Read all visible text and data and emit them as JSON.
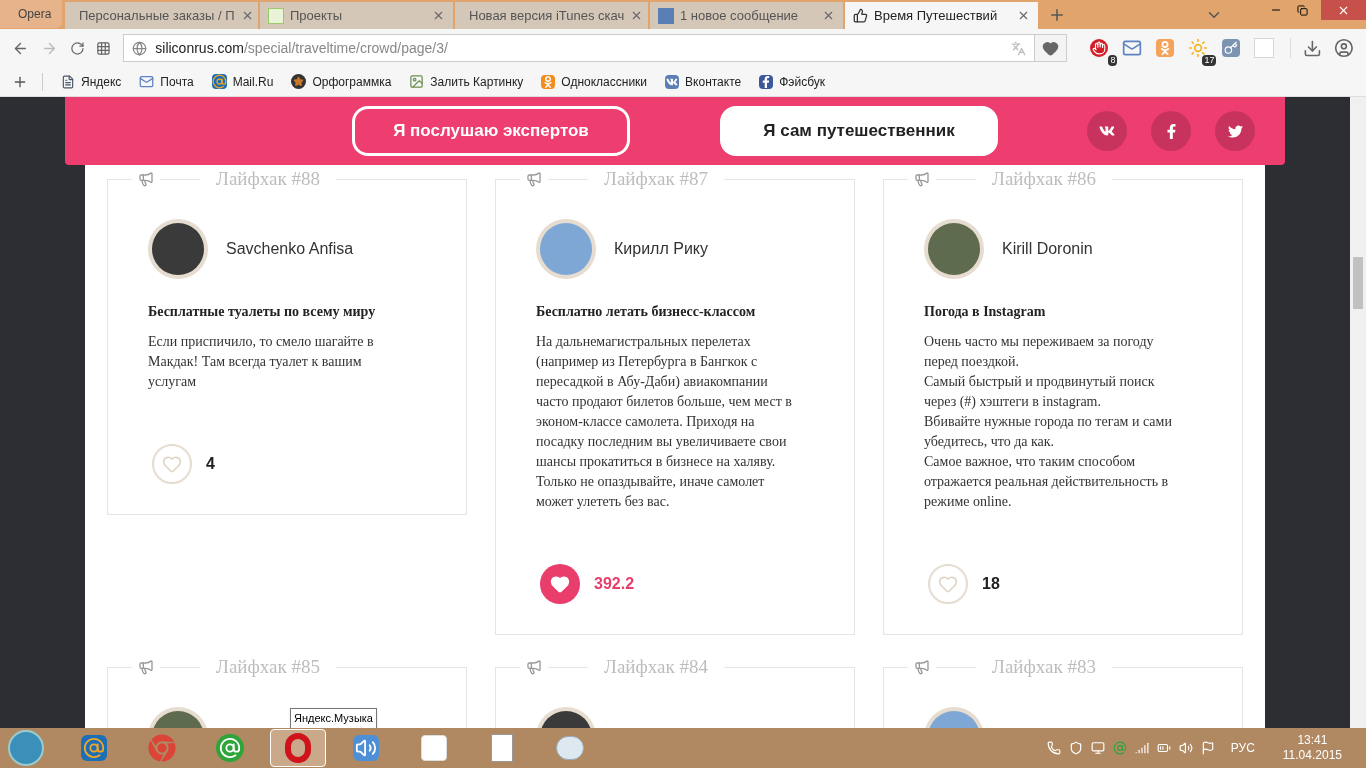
{
  "browser": {
    "menu_label": "Opera",
    "tabs": [
      {
        "kind": "letter",
        "title": "Персональные заказы / П",
        "selected": false
      },
      {
        "kind": "dots",
        "title": "Проекты",
        "selected": false
      },
      {
        "kind": "dark",
        "title": "Новая версия iTunes скач",
        "selected": false
      },
      {
        "kind": "count",
        "title": "1 новое сообщение",
        "selected": false
      },
      {
        "kind": "thumb",
        "title": "Время Путешествий",
        "selected": true
      }
    ],
    "url_host": "siliconrus.com",
    "url_path": "/special/traveltime/crowd/page/3/",
    "extensions": [
      {
        "kind": "block",
        "badge": "8"
      },
      {
        "kind": "mail"
      },
      {
        "kind": "ok"
      },
      {
        "kind": "weather",
        "badge": "17"
      },
      {
        "kind": "key"
      },
      {
        "kind": "yandex"
      }
    ],
    "bookmarks": [
      {
        "kind": "page",
        "label": "Яндекс"
      },
      {
        "kind": "mail",
        "label": "Почта"
      },
      {
        "kind": "at",
        "label": "Mail.Ru"
      },
      {
        "kind": "star",
        "label": "Орфограммка"
      },
      {
        "kind": "image",
        "label": "Залить Картинку"
      },
      {
        "kind": "ok",
        "label": "Одноклассники"
      },
      {
        "kind": "vk",
        "label": "Вконтакте"
      },
      {
        "kind": "fb",
        "label": "Фэйсбук"
      }
    ]
  },
  "header": {
    "buttons": [
      {
        "label": "Я послушаю экспертов",
        "selected": false
      },
      {
        "label": "Я сам путешественник",
        "selected": true
      }
    ],
    "social": [
      {
        "kind": "vk"
      },
      {
        "kind": "facebook"
      },
      {
        "kind": "twitter"
      }
    ]
  },
  "cards": [
    {
      "heading": "Лайфхак #88",
      "author": "Savchenko Anfisa",
      "title": "Бесплатные туалеты по всему миру",
      "paragraphs": [
        "Если приспичило, то смело шагайте в Макдак! Там всегда туалет к вашим услугам"
      ],
      "likes": "4",
      "liked": false
    },
    {
      "heading": "Лайфхак #87",
      "author": "Кирилл Рику",
      "title": "Бесплатно летать бизнесс-классом",
      "paragraphs": [
        "На дальнемагистральных перелетах (например из Петербурга в Бангкок с пересадкой в Абу-Даби) авиакомпании часто продают билетов больше, чем мест в эконом-классе самолета. Приходя на посадку последним вы увеличиваете свои шансы прокатиться в бизнесе на халяву. Только не опаздывайте, иначе самолет может улететь без вас."
      ],
      "likes": "392.2",
      "liked": true
    },
    {
      "heading": "Лайфхак #86",
      "author": "Kirill Doronin",
      "title": "Погода в Instagram",
      "paragraphs": [
        "Очень часто мы переживаем за погоду перед поездкой.",
        "Самый быстрый и продвинутый поиск через (#) хэштеги в instagram.",
        "Вбивайте нужные города по тегам и сами убедитесь, что да как.",
        "Самое важное, что таким способом отражается реальная действительность в режиме online."
      ],
      "likes": "18",
      "liked": false
    }
  ],
  "next_cards": [
    {
      "heading": "Лайфхак #85"
    },
    {
      "heading": "Лайфхак #84"
    },
    {
      "heading": "Лайфхак #83"
    }
  ],
  "tooltip": "Яндекс.Музыка",
  "taskbar": {
    "apps": [
      {
        "kind": "mail",
        "selected": false
      },
      {
        "kind": "chrome",
        "selected": false
      },
      {
        "kind": "chat",
        "selected": false
      },
      {
        "kind": "opera",
        "selected": true
      },
      {
        "kind": "speaker",
        "selected": false
      },
      {
        "kind": "yandex",
        "selected": false
      },
      {
        "kind": "font",
        "selected": false
      },
      {
        "kind": "paint",
        "selected": false
      }
    ],
    "language": "РУС",
    "time": "13:41",
    "date": "11.04.2015"
  }
}
